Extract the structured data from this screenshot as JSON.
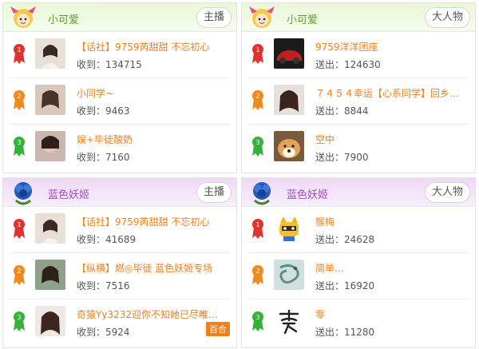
{
  "panels": [
    {
      "title": "小可爱",
      "button": "主播",
      "items": [
        {
          "title": "【话社】9759芮甜甜 不忘初心",
          "stat": "收到：134715"
        },
        {
          "title": "小同学~",
          "stat": "收到：9463"
        },
        {
          "title": "娱+毕徒酸奶",
          "stat": "收到：7160"
        }
      ]
    },
    {
      "title": "小可爱",
      "button": "大人物",
      "items": [
        {
          "title": "9759洋洋团座",
          "stat": "送出：124630"
        },
        {
          "title": "７４５４幸运【心系同学】回乡…",
          "stat": "送出：8844"
        },
        {
          "title": "空中",
          "stat": "送出：7900"
        }
      ]
    },
    {
      "title": "蓝色妖姬",
      "button": "主播",
      "items": [
        {
          "title": "【话社】9759芮甜甜 不忘初心",
          "stat": "收到：41689"
        },
        {
          "title": "【纵横】燃◎毕徒 蓝色妖姬专场",
          "stat": "收到：7516"
        },
        {
          "title": "奇猿Yy3232迎你不知她已尽唯有…",
          "stat": "收到：5924",
          "badge": "百合"
        }
      ]
    },
    {
      "title": "蓝色妖姬",
      "button": "大人物",
      "items": [
        {
          "title": "猴梅",
          "stat": "送出：24628"
        },
        {
          "title": "简单…",
          "stat": "送出：16920"
        },
        {
          "title": "零",
          "stat": "送出：11280"
        }
      ]
    }
  ],
  "colors": {
    "accent": "#f07f1d",
    "rank1": "#e0332f",
    "rank2": "#f08a1c",
    "rank3": "#37b13a"
  }
}
